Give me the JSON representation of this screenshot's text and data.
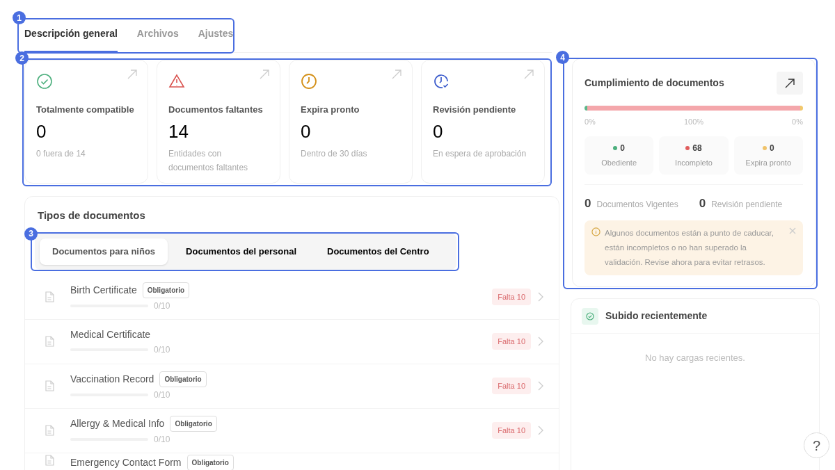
{
  "annotations": [
    {
      "number": "1"
    },
    {
      "number": "2"
    },
    {
      "number": "3"
    },
    {
      "number": "4"
    }
  ],
  "tabs": [
    {
      "label": "Descripción general",
      "selected": true
    },
    {
      "label": "Archivos",
      "selected": false
    },
    {
      "label": "Ajustes",
      "selected": false
    }
  ],
  "stats": [
    {
      "kind": "check",
      "title": "Totalmente compatible",
      "value": "0",
      "note": "0 fuera de 14"
    },
    {
      "kind": "warning",
      "title": "Documentos faltantes",
      "value": "14",
      "note": "Entidades con documentos faltantes"
    },
    {
      "kind": "clock",
      "title": "Expira pronto",
      "value": "0",
      "note": "Dentro de 30 días"
    },
    {
      "kind": "review",
      "title": "Revisión pendiente",
      "value": "0",
      "note": "En espera de aprobación"
    }
  ],
  "document_types": {
    "title": "Tipos de documentos",
    "tabs": [
      {
        "label": "Documentos para niños",
        "selected": true
      },
      {
        "label": "Documentos del personal",
        "selected": false
      },
      {
        "label": "Documentos del Centro",
        "selected": false
      }
    ],
    "rows": [
      {
        "name": "Birth Certificate",
        "badge": "Obligatorio",
        "level": 0,
        "count": "0/10",
        "status": "Falta 10"
      },
      {
        "name": "Medical Certificate",
        "level": 0,
        "count": "0/10",
        "status": "Falta 10"
      },
      {
        "name": "Vaccination Record",
        "badge": "Obligatorio",
        "level": 0,
        "count": "0/10",
        "status": "Falta 10"
      },
      {
        "name": "Allergy & Medical Info",
        "badge": "Obligatorio",
        "level": 0,
        "count": "0/10",
        "status": "Falta 10"
      },
      {
        "name": "Emergency Contact Form",
        "badge": "Obligatorio"
      }
    ]
  },
  "compliance": {
    "title": "Cumplimiento de documentos",
    "segments": [
      {
        "color": "#5cb88a",
        "level": 0
      },
      {
        "color": "#f4a7ab",
        "level": 1
      },
      {
        "color": "#f2c96b",
        "level": 0
      }
    ],
    "scale": [
      "0%",
      "100%",
      "0%"
    ],
    "legend": [
      {
        "color": "#4caf7d",
        "value": "0",
        "label": "Obediente"
      },
      {
        "color": "#e05c5c",
        "value": "68",
        "label": "Incompleto"
      },
      {
        "color": "#f0c36a",
        "value": "0",
        "label": "Expira pronto"
      }
    ],
    "totals": [
      {
        "value": "0",
        "label": "Documentos Vigentes"
      },
      {
        "value": "0",
        "label": "Revisión pendiente"
      }
    ],
    "alert": "Algunos documentos están a punto de caducar, están incompletos o no han superado la validación. Revise ahora para evitar retrasos."
  },
  "recent": {
    "title": "Subido recientemente",
    "empty": "No hay cargas recientes."
  },
  "help": "?"
}
